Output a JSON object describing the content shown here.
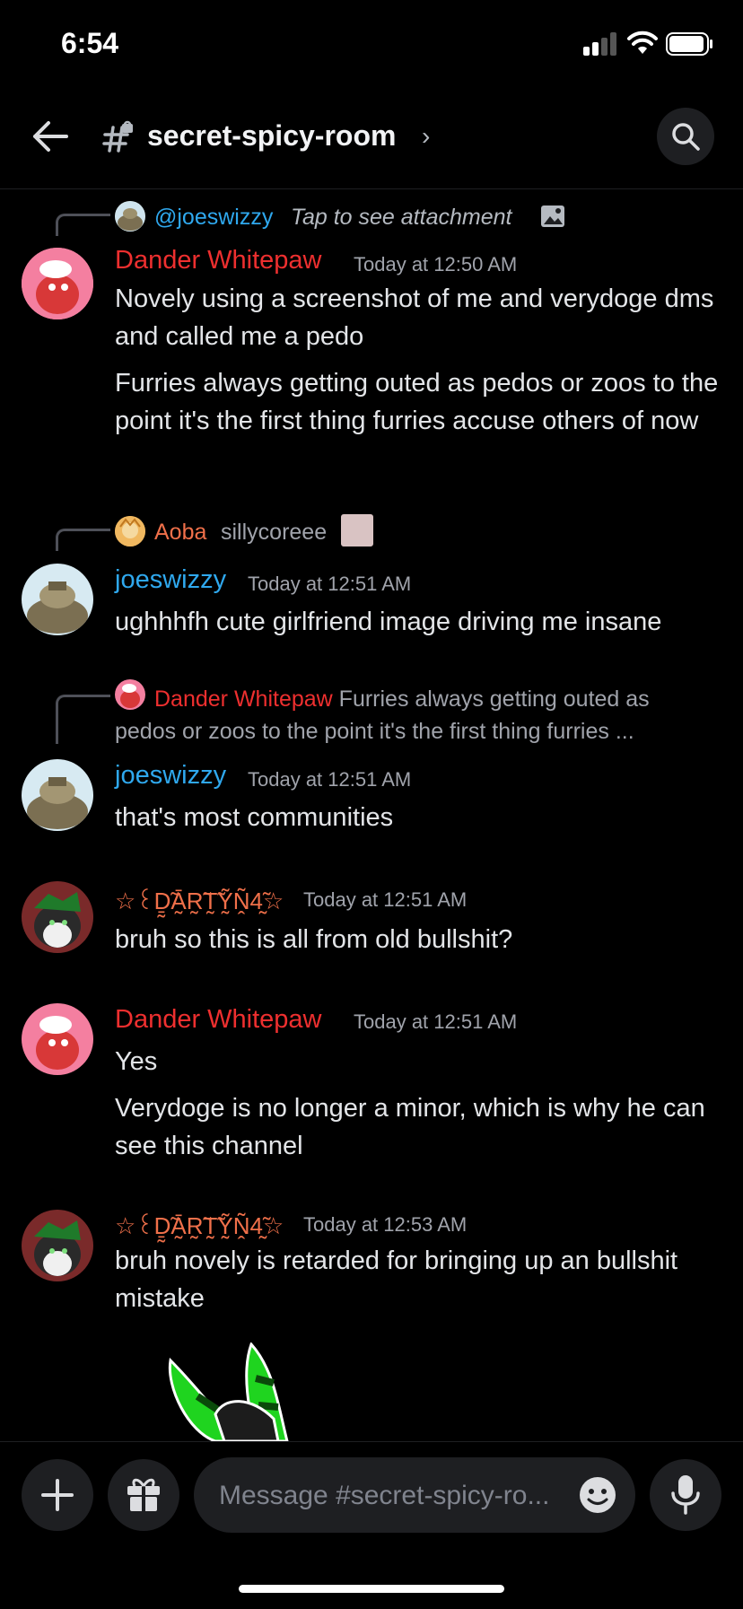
{
  "status": {
    "time": "6:54"
  },
  "header": {
    "channel": "secret-spicy-room",
    "chevron": "›"
  },
  "messages": [
    {
      "reply": {
        "user": "@joeswizzy",
        "text": "Tap to see attachment"
      },
      "author": "Dander Whitepaw",
      "time": "Today at 12:50 AM",
      "lines": [
        "Novely using a screenshot of me and verydoge dms and called me a pedo",
        "Furries always getting outed as pedos or zoos to the point it's the first thing furries accuse others of now"
      ]
    },
    {
      "reply": {
        "user": "Aoba",
        "text": "sillycoreee"
      },
      "author": "joeswizzy",
      "time": "Today at 12:51 AM",
      "lines": [
        "ughhhfh cute girlfriend image driving me insane"
      ]
    },
    {
      "reply": {
        "user": "Dander Whitepaw",
        "text": "Furries always getting outed as pedos or zoos to the point it's the first thing furries ..."
      },
      "author": "joeswizzy",
      "time": "Today at 12:51 AM",
      "lines": [
        "that's most communities"
      ]
    },
    {
      "author": "☆꒰Ḏ̰̃Ā̰R̰̃T̰̃Ỹ̰Ṋ̃4̰̃☆",
      "time": "Today at 12:51 AM",
      "lines": [
        "bruh so this is all from old bullshit?"
      ]
    },
    {
      "author": "Dander Whitepaw",
      "time": "Today at 12:51 AM",
      "lines": [
        "Yes",
        "Verydoge is no longer a minor, which is why he can see this channel"
      ]
    },
    {
      "author": "☆꒰Ḏ̰̃Ā̰R̰̃T̰̃Ỹ̰Ṋ̃4̰̃☆",
      "time": "Today at 12:53 AM",
      "lines": [
        "bruh novely is retarded for bringing up an bullshit mistake"
      ]
    }
  ],
  "composer": {
    "placeholder": "Message #secret-spicy-ro..."
  },
  "colors": {
    "red_name": "#ee2f2f",
    "blue_name": "#2fa8ee",
    "orange_name": "#f0704a",
    "background": "#000000"
  },
  "icons": [
    "back-arrow-icon",
    "channel-hash-lock-icon",
    "search-icon",
    "image-icon",
    "plus-icon",
    "gift-icon",
    "emoji-icon",
    "microphone-icon"
  ]
}
